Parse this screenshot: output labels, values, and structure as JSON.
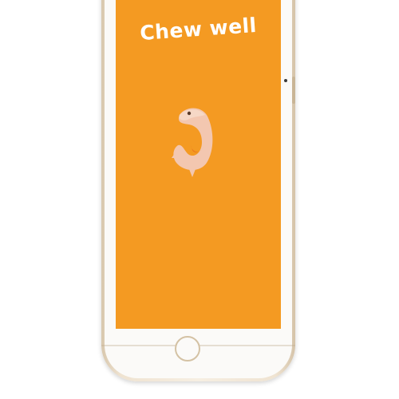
{
  "app": {
    "title": "Chew well",
    "background_color": "#f49a22",
    "mascot_icon": "fish-mascot-icon"
  },
  "device": {
    "frame_color": "#efe3d1",
    "home_button_icon": "home-button-circle"
  }
}
